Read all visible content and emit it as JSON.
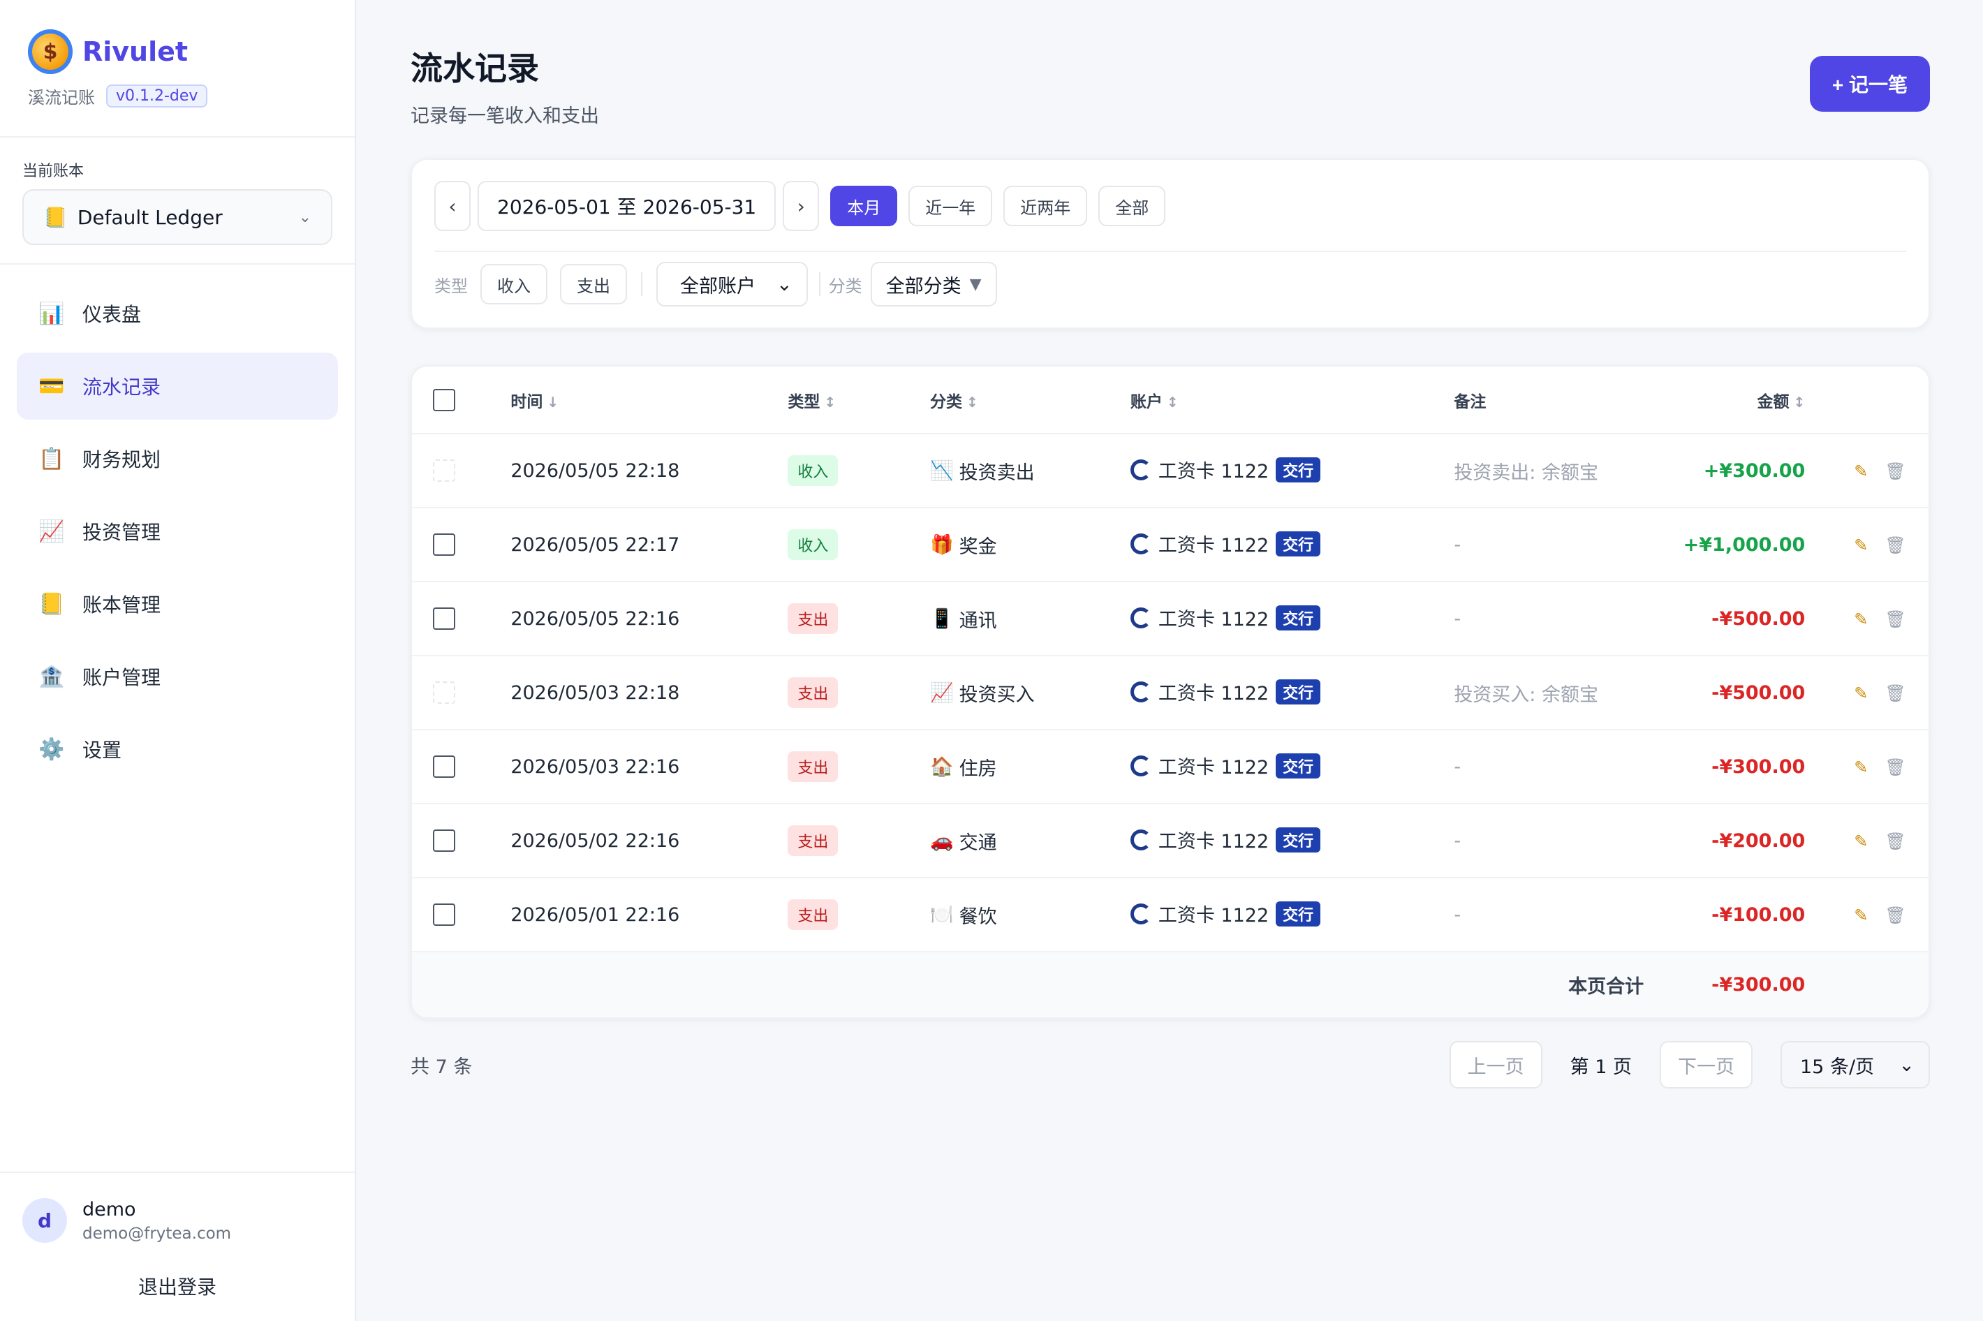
{
  "brand": {
    "name": "Rivulet",
    "subtitle": "溪流记账",
    "version": "v0.1.2-dev",
    "logo_icon": "coin-icon"
  },
  "ledger": {
    "label": "当前账本",
    "selected": "Default Ledger",
    "icon": "📒"
  },
  "nav": [
    {
      "label": "仪表盘",
      "icon": "📊",
      "active": false
    },
    {
      "label": "流水记录",
      "icon": "💳",
      "active": true
    },
    {
      "label": "财务规划",
      "icon": "📋",
      "active": false
    },
    {
      "label": "投资管理",
      "icon": "📈",
      "active": false
    },
    {
      "label": "账本管理",
      "icon": "📒",
      "active": false
    },
    {
      "label": "账户管理",
      "icon": "🏦",
      "active": false
    },
    {
      "label": "设置",
      "icon": "⚙️",
      "active": false
    }
  ],
  "user": {
    "initial": "d",
    "name": "demo",
    "email": "demo@frytea.com",
    "logout": "退出登录"
  },
  "page": {
    "title": "流水记录",
    "subtitle": "记录每一笔收入和支出",
    "add_button": "+ 记一笔"
  },
  "filters": {
    "prev": "‹",
    "next": "›",
    "date_range": "2026-05-01 至 2026-05-31",
    "ranges": [
      "本月",
      "近一年",
      "近两年",
      "全部"
    ],
    "type_label": "类型",
    "type_income": "收入",
    "type_expense": "支出",
    "account_select": "全部账户",
    "category_label": "分类",
    "category_select": "全部分类"
  },
  "table": {
    "headers": {
      "time": "时间",
      "type": "类型",
      "category": "分类",
      "account": "账户",
      "note": "备注",
      "amount": "金额"
    },
    "rows": [
      {
        "time": "2026/05/05 22:18",
        "type": "收入",
        "kind": "in",
        "cat_icon": "📉",
        "category": "投资卖出",
        "account": "工资卡 1122",
        "bank": "交行",
        "note": "投资卖出: 余额宝",
        "amount": "+¥300.00",
        "checkable": false
      },
      {
        "time": "2026/05/05 22:17",
        "type": "收入",
        "kind": "in",
        "cat_icon": "🎁",
        "category": "奖金",
        "account": "工资卡 1122",
        "bank": "交行",
        "note": "-",
        "amount": "+¥1,000.00",
        "checkable": true
      },
      {
        "time": "2026/05/05 22:16",
        "type": "支出",
        "kind": "out",
        "cat_icon": "📱",
        "category": "通讯",
        "account": "工资卡 1122",
        "bank": "交行",
        "note": "-",
        "amount": "-¥500.00",
        "checkable": true
      },
      {
        "time": "2026/05/03 22:18",
        "type": "支出",
        "kind": "out",
        "cat_icon": "📈",
        "category": "投资买入",
        "account": "工资卡 1122",
        "bank": "交行",
        "note": "投资买入: 余额宝",
        "amount": "-¥500.00",
        "checkable": false
      },
      {
        "time": "2026/05/03 22:16",
        "type": "支出",
        "kind": "out",
        "cat_icon": "🏠",
        "category": "住房",
        "account": "工资卡 1122",
        "bank": "交行",
        "note": "-",
        "amount": "-¥300.00",
        "checkable": true
      },
      {
        "time": "2026/05/02 22:16",
        "type": "支出",
        "kind": "out",
        "cat_icon": "🚗",
        "category": "交通",
        "account": "工资卡 1122",
        "bank": "交行",
        "note": "-",
        "amount": "-¥200.00",
        "checkable": true
      },
      {
        "time": "2026/05/01 22:16",
        "type": "支出",
        "kind": "out",
        "cat_icon": "🍽️",
        "category": "餐饮",
        "account": "工资卡 1122",
        "bank": "交行",
        "note": "-",
        "amount": "-¥100.00",
        "checkable": true
      }
    ],
    "footer_label": "本页合计",
    "footer_total": "-¥300.00"
  },
  "pagination": {
    "total": "共 7 条",
    "prev": "上一页",
    "current": "第 1 页",
    "next": "下一页",
    "page_size": "15 条/页"
  },
  "colors": {
    "accent": "#4f46e5",
    "income": "#16a34a",
    "expense": "#dc2626"
  }
}
